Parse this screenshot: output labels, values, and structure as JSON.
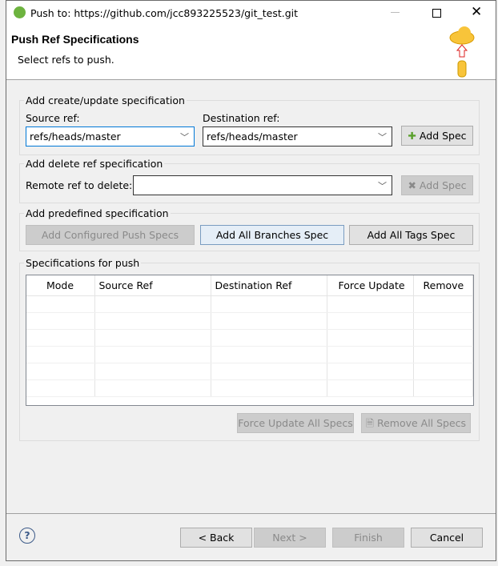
{
  "window": {
    "title": "Push to: https://github.com/jcc893225523/git_test.git",
    "controls": [
      "minimize",
      "maximize",
      "close"
    ]
  },
  "header": {
    "title": "Push Ref Specifications",
    "subtitle": "Select refs to push."
  },
  "create": {
    "legend": "Add create/update specification",
    "source_label": "Source ref:",
    "source_value": "refs/heads/master",
    "dest_label": "Destination ref:",
    "dest_value": "refs/heads/master",
    "add_label": "Add Spec"
  },
  "delete": {
    "legend": "Add delete ref specification",
    "remote_label": "Remote ref to delete:",
    "remote_value": "",
    "add_label": "Add Spec"
  },
  "predef": {
    "legend": "Add predefined specification",
    "configured": "Add Configured Push Specs",
    "branches": "Add All Branches Spec",
    "tags": "Add All Tags Spec"
  },
  "specs": {
    "legend": "Specifications for push",
    "columns": [
      "Mode",
      "Source Ref",
      "Destination Ref",
      "Force Update",
      "Remove"
    ],
    "rows": [],
    "force_all": "Force Update All Specs",
    "remove_all": "Remove All Specs"
  },
  "footer": {
    "back": "< Back",
    "next": "Next >",
    "finish": "Finish",
    "cancel": "Cancel"
  }
}
